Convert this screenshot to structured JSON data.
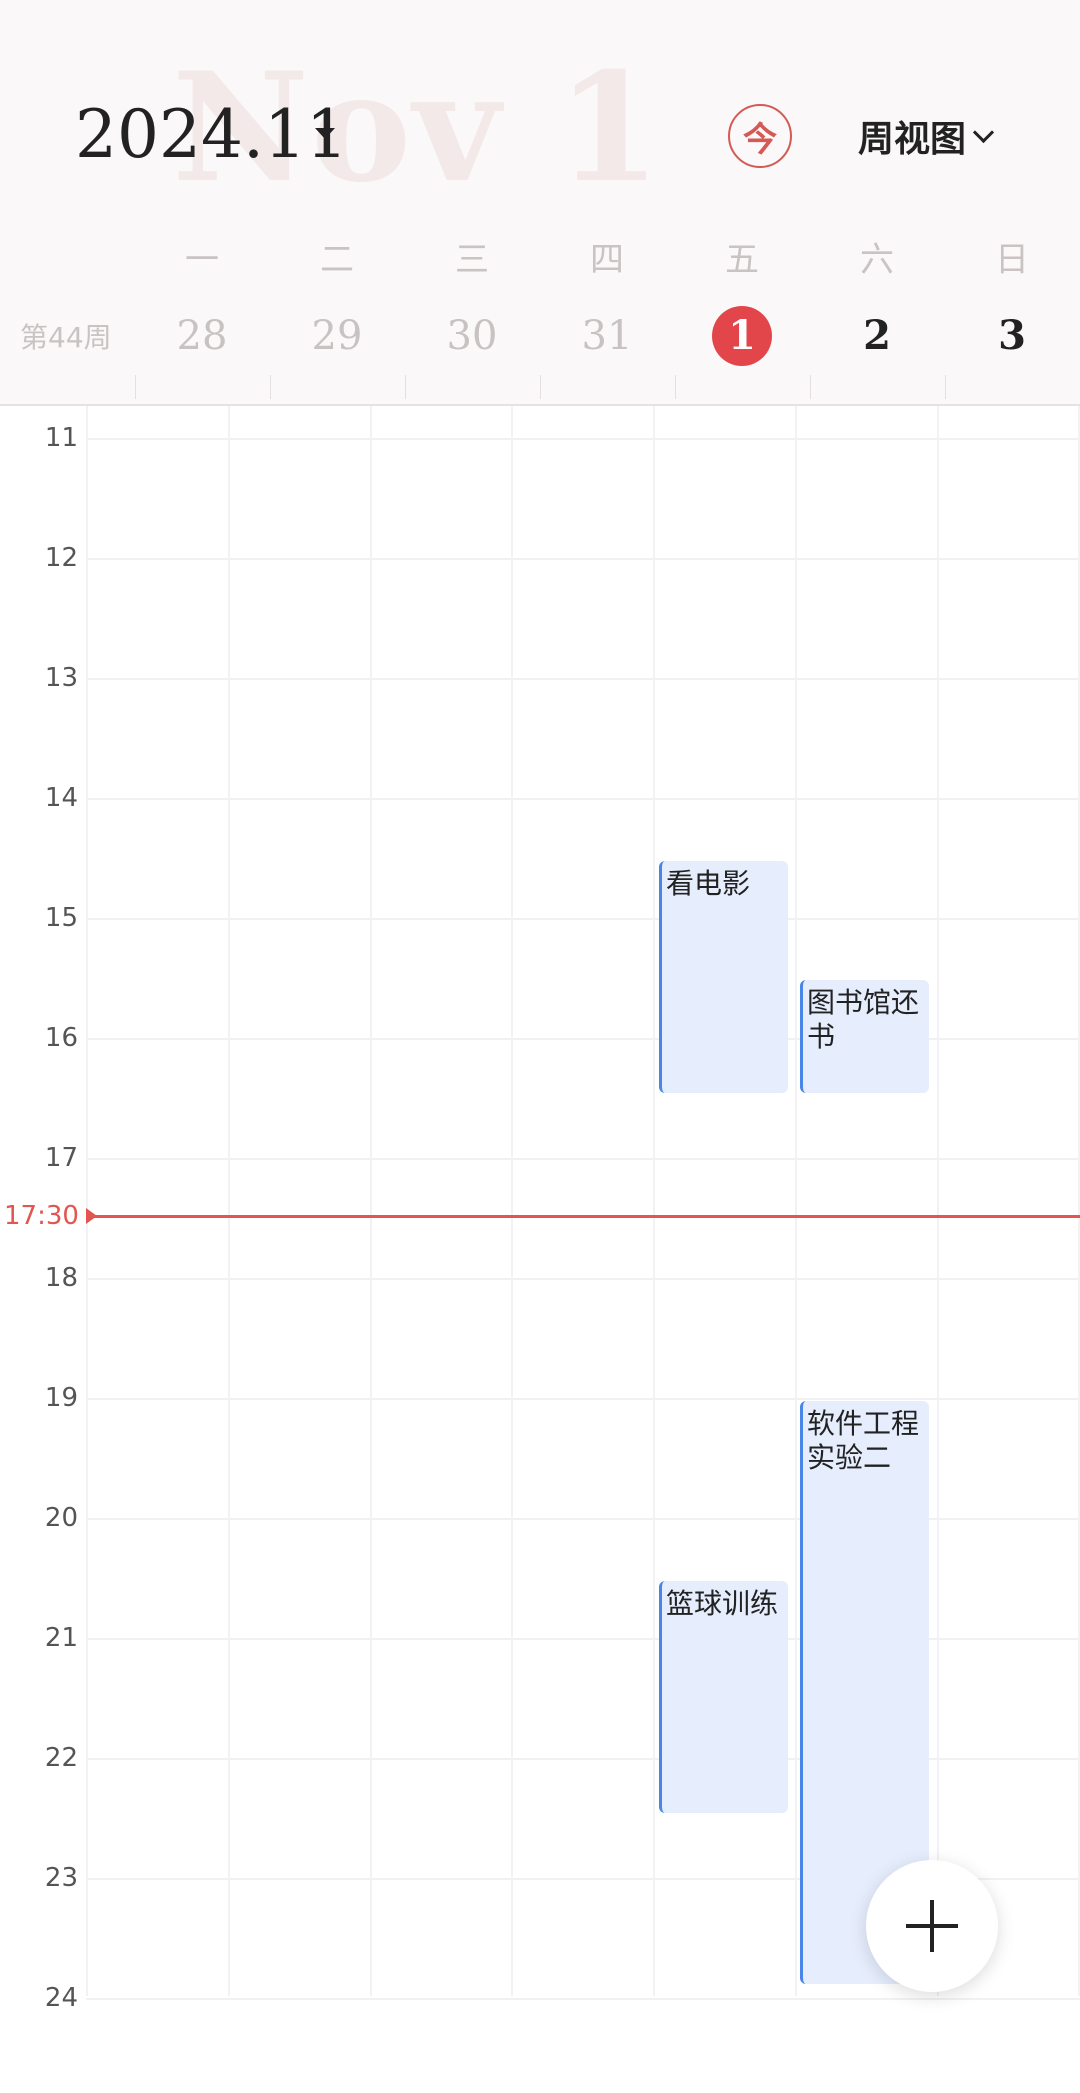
{
  "header": {
    "ghost_text": "Nov 1",
    "month_title": "2024.11",
    "today_button": "今",
    "view_selector": "周视图",
    "week_label": "第44周",
    "weekdays": [
      "一",
      "二",
      "三",
      "四",
      "五",
      "六",
      "日"
    ],
    "dates": [
      "28",
      "29",
      "30",
      "31",
      "1",
      "2",
      "3"
    ],
    "selected_date": "1"
  },
  "timeline": {
    "hours": [
      "11",
      "12",
      "13",
      "14",
      "15",
      "16",
      "17",
      "18",
      "19",
      "20",
      "21",
      "22",
      "23",
      "24"
    ],
    "current_time": "17:30"
  },
  "events": [
    {
      "title": "看电影",
      "day": "五"
    },
    {
      "title": "图书馆还书",
      "day": "六"
    },
    {
      "title": "软件工程实验二",
      "day": "六"
    },
    {
      "title": "篮球训练",
      "day": "五"
    }
  ],
  "colors": {
    "accent": "#e2464b",
    "event_bg": "#e6edfd",
    "event_border": "#4a86e8",
    "now_line": "#e25550"
  },
  "fab_icon": "plus-icon"
}
